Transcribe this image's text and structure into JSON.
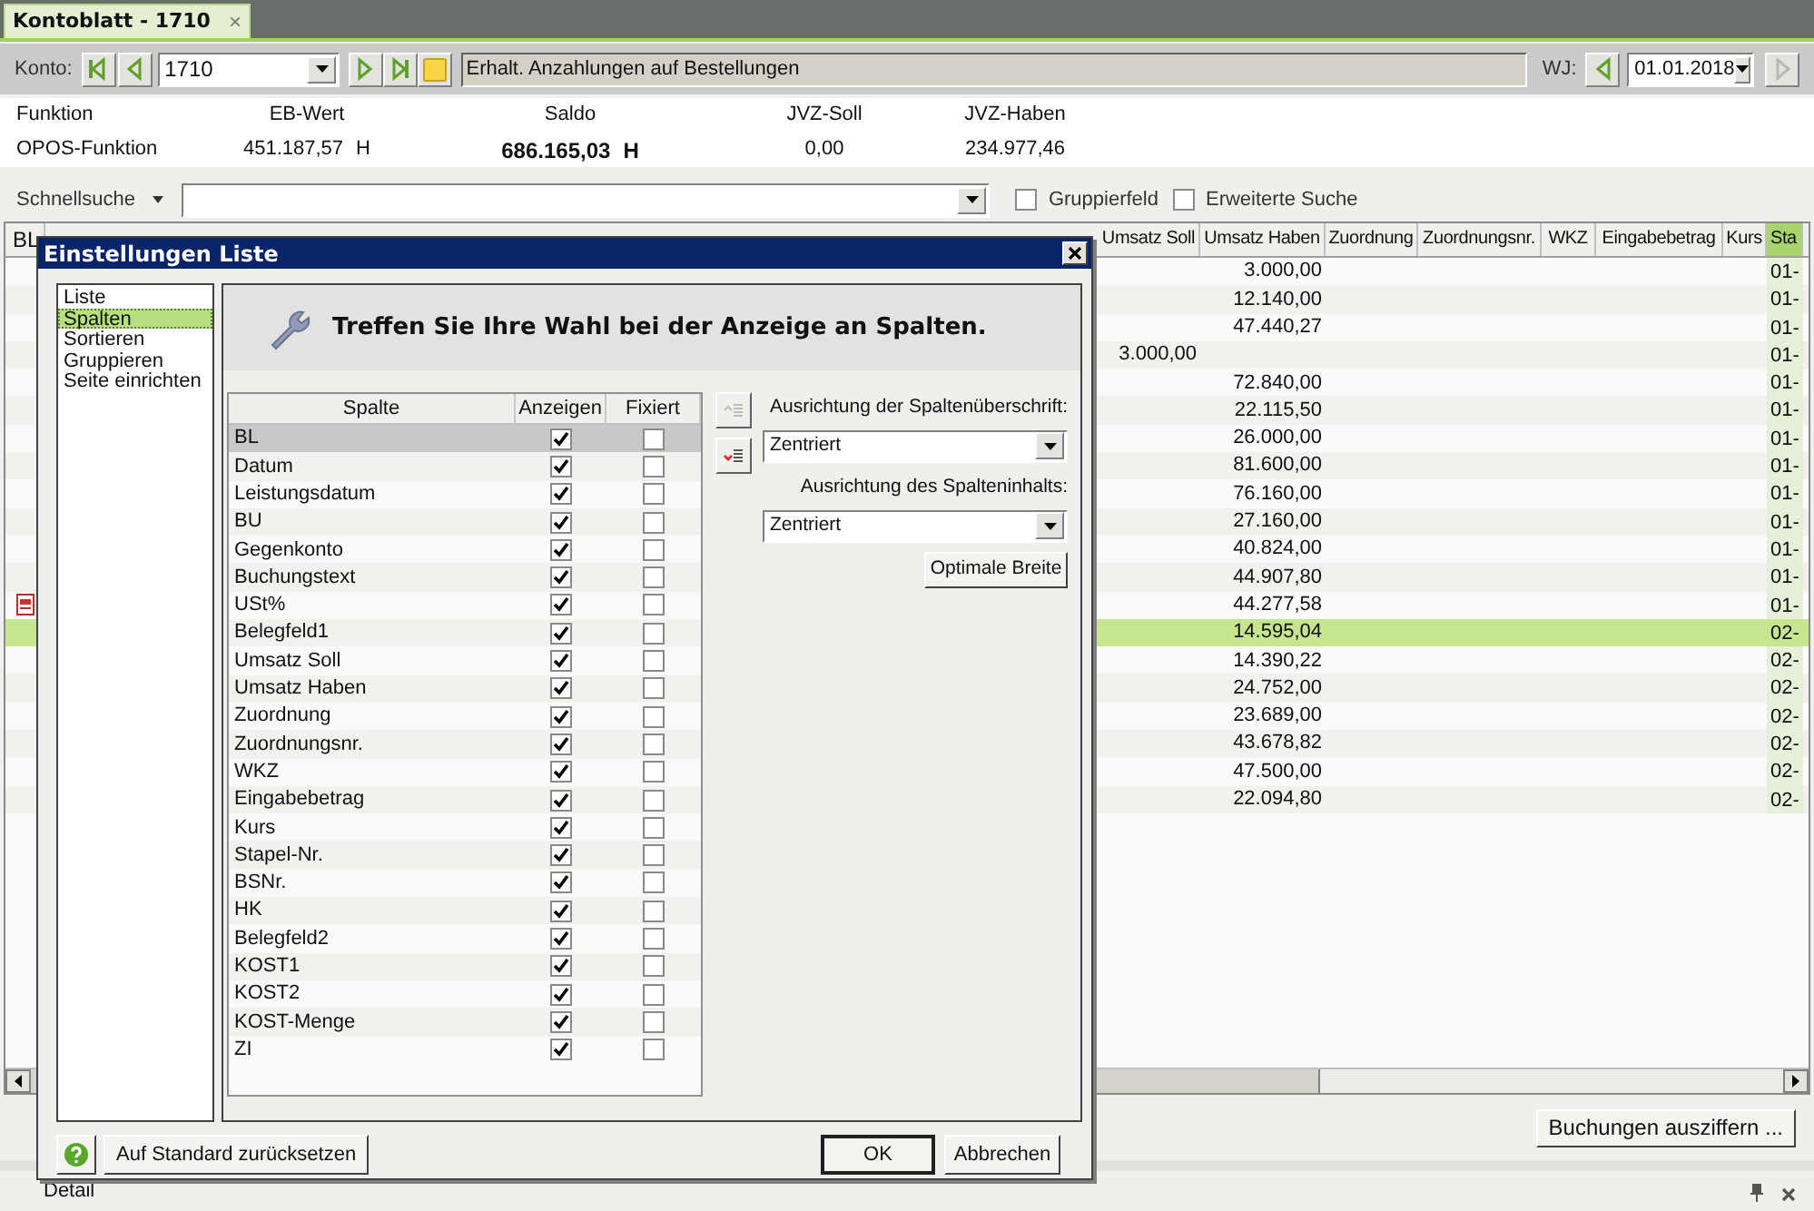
{
  "tab": {
    "title": "Kontoblatt - 1710",
    "close": "×"
  },
  "toolbar": {
    "konto_label": "Konto:",
    "konto": "1710",
    "description": "Erhalt. Anzahlungen auf Bestellungen",
    "wj_label": "WJ:",
    "wj": "01.01.2018"
  },
  "info": [
    {
      "label": "Funktion",
      "value": "OPOS-Funktion",
      "bold": false
    },
    {
      "label": "EB-Wert",
      "value": "451.187,57",
      "suffix": "H",
      "bold": false
    },
    {
      "label": "Saldo",
      "value": "686.165,03",
      "suffix": "H",
      "bold": true
    },
    {
      "label": "JVZ-Soll",
      "value": "0,00",
      "bold": false
    },
    {
      "label": "JVZ-Haben",
      "value": "234.977,46",
      "bold": false
    }
  ],
  "search": {
    "label": "Schnellsuche",
    "options": [
      {
        "label": "Gruppierfeld",
        "checked": false
      },
      {
        "label": "Erweiterte Suche",
        "checked": false
      }
    ]
  },
  "grid": {
    "first_column": "BL",
    "columns": [
      {
        "label": "Umsatz Soll",
        "highlighted": false
      },
      {
        "label": "Umsatz Haben",
        "highlighted": false
      },
      {
        "label": "Zuordnung",
        "highlighted": false
      },
      {
        "label": "Zuordnungsnr.",
        "highlighted": false
      },
      {
        "label": "WKZ",
        "highlighted": false
      },
      {
        "label": "Eingabebetrag",
        "highlighted": false
      },
      {
        "label": "Kurs",
        "highlighted": false
      },
      {
        "label": "Sta",
        "highlighted": true
      }
    ],
    "rows": [
      {
        "soll": "",
        "haben": "3.000,00",
        "stapel": "01-",
        "selected": false,
        "note": false
      },
      {
        "soll": "",
        "haben": "12.140,00",
        "stapel": "01-",
        "selected": false,
        "note": false
      },
      {
        "soll": "",
        "haben": "47.440,27",
        "stapel": "01-",
        "selected": false,
        "note": false
      },
      {
        "soll": "3.000,00",
        "haben": "",
        "stapel": "01-",
        "selected": false,
        "note": false
      },
      {
        "soll": "",
        "haben": "72.840,00",
        "stapel": "01-",
        "selected": false,
        "note": false
      },
      {
        "soll": "",
        "haben": "22.115,50",
        "stapel": "01-",
        "selected": false,
        "note": false
      },
      {
        "soll": "",
        "haben": "26.000,00",
        "stapel": "01-",
        "selected": false,
        "note": false
      },
      {
        "soll": "",
        "haben": "81.600,00",
        "stapel": "01-",
        "selected": false,
        "note": false
      },
      {
        "soll": "",
        "haben": "76.160,00",
        "stapel": "01-",
        "selected": false,
        "note": false
      },
      {
        "soll": "",
        "haben": "27.160,00",
        "stapel": "01-",
        "selected": false,
        "note": false
      },
      {
        "soll": "",
        "haben": "40.824,00",
        "stapel": "01-",
        "selected": false,
        "note": false
      },
      {
        "soll": "",
        "haben": "44.907,80",
        "stapel": "01-",
        "selected": false,
        "note": false
      },
      {
        "soll": "",
        "haben": "44.277,58",
        "stapel": "01-",
        "selected": false,
        "note": true
      },
      {
        "soll": "",
        "haben": "14.595,04",
        "stapel": "02-",
        "selected": true,
        "note": false
      },
      {
        "soll": "",
        "haben": "14.390,22",
        "stapel": "02-",
        "selected": false,
        "note": false
      },
      {
        "soll": "",
        "haben": "24.752,00",
        "stapel": "02-",
        "selected": false,
        "note": false
      },
      {
        "soll": "",
        "haben": "23.689,00",
        "stapel": "02-",
        "selected": false,
        "note": false
      },
      {
        "soll": "",
        "haben": "43.678,82",
        "stapel": "02-",
        "selected": false,
        "note": false
      },
      {
        "soll": "",
        "haben": "47.500,00",
        "stapel": "02-",
        "selected": false,
        "note": false
      },
      {
        "soll": "",
        "haben": "22.094,80",
        "stapel": "02-",
        "selected": false,
        "note": false
      }
    ]
  },
  "action_button": "Buchungen ausziffern ...",
  "status_bar": {
    "label": "Detail"
  },
  "dialog": {
    "title": "Einstellungen Liste",
    "nav": [
      {
        "label": "Liste",
        "selected": false
      },
      {
        "label": "Spalten",
        "selected": true
      },
      {
        "label": "Sortieren",
        "selected": false
      },
      {
        "label": "Gruppieren",
        "selected": false
      },
      {
        "label": "Seite einrichten",
        "selected": false
      }
    ],
    "heading": "Treffen Sie Ihre Wahl bei der Anzeige an Spalten.",
    "table": {
      "headers": [
        "Spalte",
        "Anzeigen",
        "Fixiert"
      ],
      "rows": [
        {
          "name": "BL",
          "show": true,
          "fixed": false,
          "selected": true
        },
        {
          "name": "Datum",
          "show": true,
          "fixed": false,
          "selected": false
        },
        {
          "name": "Leistungsdatum",
          "show": true,
          "fixed": false,
          "selected": false
        },
        {
          "name": "BU",
          "show": true,
          "fixed": false,
          "selected": false
        },
        {
          "name": "Gegenkonto",
          "show": true,
          "fixed": false,
          "selected": false
        },
        {
          "name": "Buchungstext",
          "show": true,
          "fixed": false,
          "selected": false
        },
        {
          "name": "USt%",
          "show": true,
          "fixed": false,
          "selected": false
        },
        {
          "name": "Belegfeld1",
          "show": true,
          "fixed": false,
          "selected": false
        },
        {
          "name": "Umsatz Soll",
          "show": true,
          "fixed": false,
          "selected": false
        },
        {
          "name": "Umsatz Haben",
          "show": true,
          "fixed": false,
          "selected": false
        },
        {
          "name": "Zuordnung",
          "show": true,
          "fixed": false,
          "selected": false
        },
        {
          "name": "Zuordnungsnr.",
          "show": true,
          "fixed": false,
          "selected": false
        },
        {
          "name": "WKZ",
          "show": true,
          "fixed": false,
          "selected": false
        },
        {
          "name": "Eingabebetrag",
          "show": true,
          "fixed": false,
          "selected": false
        },
        {
          "name": "Kurs",
          "show": true,
          "fixed": false,
          "selected": false
        },
        {
          "name": "Stapel-Nr.",
          "show": true,
          "fixed": false,
          "selected": false
        },
        {
          "name": "BSNr.",
          "show": true,
          "fixed": false,
          "selected": false
        },
        {
          "name": "HK",
          "show": true,
          "fixed": false,
          "selected": false
        },
        {
          "name": "Belegfeld2",
          "show": true,
          "fixed": false,
          "selected": false
        },
        {
          "name": "KOST1",
          "show": true,
          "fixed": false,
          "selected": false
        },
        {
          "name": "KOST2",
          "show": true,
          "fixed": false,
          "selected": false
        },
        {
          "name": "KOST-Menge",
          "show": true,
          "fixed": false,
          "selected": false
        },
        {
          "name": "ZI",
          "show": true,
          "fixed": false,
          "selected": false
        }
      ]
    },
    "header_align_label": "Ausrichtung der Spaltenüberschrift:",
    "header_align": "Zentriert",
    "content_align_label": "Ausrichtung des Spalteninhalts:",
    "content_align": "Zentriert",
    "optimal_button": "Optimale Breite",
    "reset_button": "Auf Standard zurücksetzen",
    "ok_button": "OK",
    "cancel_button": "Abbrechen"
  }
}
